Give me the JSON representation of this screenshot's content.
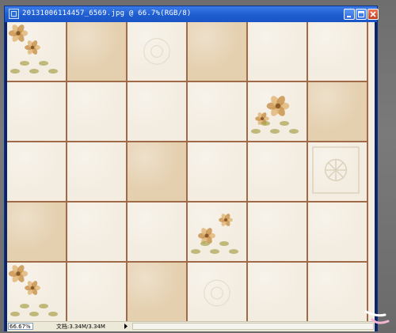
{
  "window": {
    "title": "20131006114457_6569.jpg @ 66.7%(RGB/8)"
  },
  "status": {
    "zoom": "66.67%",
    "doc_info": "文档:3.34M/3.34M"
  },
  "colors": {
    "titlebar": "#1f5fd1",
    "grout": "#a06a48",
    "tile_light": "#f3ece0",
    "tile_tan": "#e4cfae",
    "workspace": "#7a7a7a"
  },
  "icons": {
    "title_icon": "photoshop-document-icon",
    "minimize": "minimize-icon",
    "maximize": "maximize-icon",
    "close": "close-icon",
    "arrow": "status-menu-arrow-icon"
  },
  "tiles": [
    [
      "floral",
      "tan",
      "pattern",
      "tan",
      "light",
      "light"
    ],
    [
      "light",
      "light",
      "light",
      "light",
      "floral",
      "tan"
    ],
    [
      "light",
      "light",
      "tan",
      "light",
      "light",
      "medallion"
    ],
    [
      "tan",
      "light",
      "light",
      "floral",
      "light",
      "light"
    ],
    [
      "floral",
      "light",
      "tan",
      "pattern",
      "light",
      "light"
    ]
  ]
}
